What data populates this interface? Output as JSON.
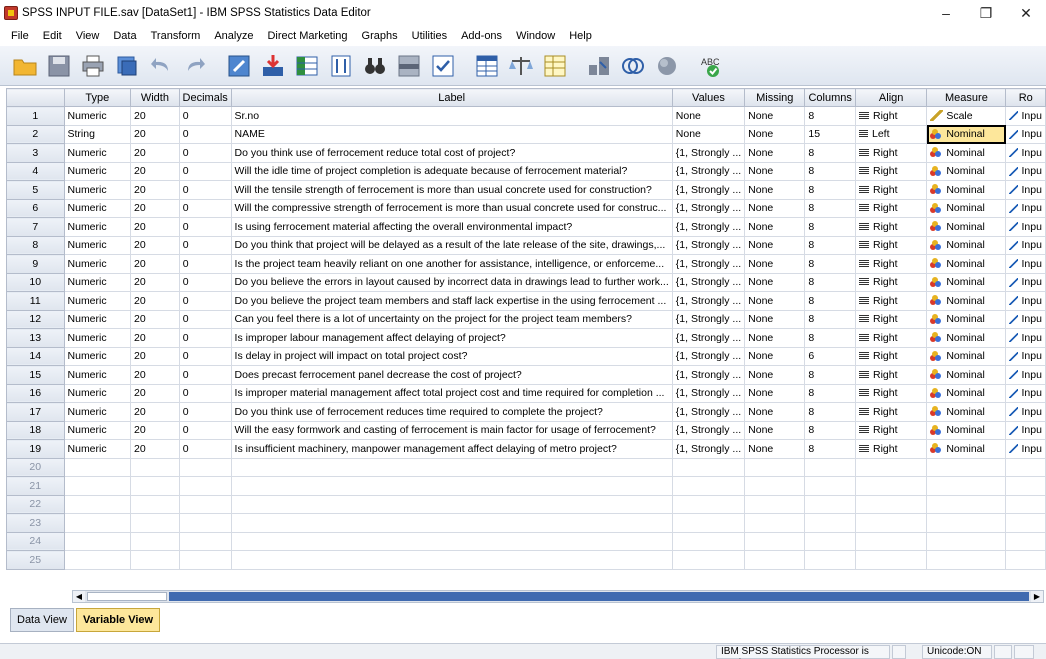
{
  "window": {
    "title": "SPSS INPUT FILE.sav [DataSet1] - IBM SPSS Statistics Data Editor",
    "minimize": "–",
    "maximize": "❐",
    "close": "✕"
  },
  "menubar": [
    {
      "label": "File"
    },
    {
      "label": "Edit"
    },
    {
      "label": "View"
    },
    {
      "label": "Data"
    },
    {
      "label": "Transform"
    },
    {
      "label": "Analyze"
    },
    {
      "label": "Direct Marketing"
    },
    {
      "label": "Graphs"
    },
    {
      "label": "Utilities"
    },
    {
      "label": "Add-ons"
    },
    {
      "label": "Window"
    },
    {
      "label": "Help"
    }
  ],
  "toolbar": {
    "spell_label": "ABC"
  },
  "grid": {
    "columns": [
      "",
      "Type",
      "Width",
      "Decimals",
      "Label",
      "Values",
      "Missing",
      "Columns",
      "Align",
      "Measure",
      "Ro"
    ],
    "rows": [
      {
        "n": "1",
        "type": "Numeric",
        "width": "20",
        "decimals": "0",
        "label": "Sr.no",
        "values": "None",
        "missing": "None",
        "columns": "8",
        "align": "Right",
        "measure": "Scale",
        "role": "Inpu"
      },
      {
        "n": "2",
        "type": "String",
        "width": "20",
        "decimals": "0",
        "label": "NAME",
        "values": "None",
        "missing": "None",
        "columns": "15",
        "align": "Left",
        "measure": "Nominal",
        "role": "Inpu"
      },
      {
        "n": "3",
        "type": "Numeric",
        "width": "20",
        "decimals": "0",
        "label": "Do you think use of ferrocement reduce total cost of project?",
        "values": "{1, Strongly ...",
        "missing": "None",
        "columns": "8",
        "align": "Right",
        "measure": "Nominal",
        "role": "Inpu"
      },
      {
        "n": "4",
        "type": "Numeric",
        "width": "20",
        "decimals": "0",
        "label": "Will the idle time of project completion is adequate because of ferrocement material?",
        "values": "{1, Strongly ...",
        "missing": "None",
        "columns": "8",
        "align": "Right",
        "measure": "Nominal",
        "role": "Inpu"
      },
      {
        "n": "5",
        "type": "Numeric",
        "width": "20",
        "decimals": "0",
        "label": "Will the tensile strength of ferrocement is more than usual concrete used for construction?",
        "values": "{1, Strongly ...",
        "missing": "None",
        "columns": "8",
        "align": "Right",
        "measure": "Nominal",
        "role": "Inpu"
      },
      {
        "n": "6",
        "type": "Numeric",
        "width": "20",
        "decimals": "0",
        "label": "Will the compressive strength of ferrocement is more than usual concrete used for construc...",
        "values": "{1, Strongly ...",
        "missing": "None",
        "columns": "8",
        "align": "Right",
        "measure": "Nominal",
        "role": "Inpu"
      },
      {
        "n": "7",
        "type": "Numeric",
        "width": "20",
        "decimals": "0",
        "label": "Is using ferrocement material affecting the overall environmental impact?",
        "values": "{1, Strongly ...",
        "missing": "None",
        "columns": "8",
        "align": "Right",
        "measure": "Nominal",
        "role": "Inpu"
      },
      {
        "n": "8",
        "type": "Numeric",
        "width": "20",
        "decimals": "0",
        "label": "Do you think that project will be delayed as a result of the late release of the site, drawings,...",
        "values": "{1, Strongly ...",
        "missing": "None",
        "columns": "8",
        "align": "Right",
        "measure": "Nominal",
        "role": "Inpu"
      },
      {
        "n": "9",
        "type": "Numeric",
        "width": "20",
        "decimals": "0",
        "label": "Is the project team heavily reliant on one another for assistance, intelligence, or enforceme...",
        "values": "{1, Strongly ...",
        "missing": "None",
        "columns": "8",
        "align": "Right",
        "measure": "Nominal",
        "role": "Inpu"
      },
      {
        "n": "10",
        "type": "Numeric",
        "width": "20",
        "decimals": "0",
        "label": "Do you believe the errors in layout caused by incorrect data in drawings lead to further work...",
        "values": "{1, Strongly ...",
        "missing": "None",
        "columns": "8",
        "align": "Right",
        "measure": "Nominal",
        "role": "Inpu"
      },
      {
        "n": "11",
        "type": "Numeric",
        "width": "20",
        "decimals": "0",
        "label": "Do you believe the project team members and staff lack expertise in the using ferrocement ...",
        "values": "{1, Strongly ...",
        "missing": "None",
        "columns": "8",
        "align": "Right",
        "measure": "Nominal",
        "role": "Inpu"
      },
      {
        "n": "12",
        "type": "Numeric",
        "width": "20",
        "decimals": "0",
        "label": "Can you feel there is a lot of uncertainty on the project for the project team members?",
        "values": "{1, Strongly ...",
        "missing": "None",
        "columns": "8",
        "align": "Right",
        "measure": "Nominal",
        "role": "Inpu"
      },
      {
        "n": "13",
        "type": "Numeric",
        "width": "20",
        "decimals": "0",
        "label": "Is improper labour management affect delaying of project?",
        "values": "{1, Strongly ...",
        "missing": "None",
        "columns": "8",
        "align": "Right",
        "measure": "Nominal",
        "role": "Inpu"
      },
      {
        "n": "14",
        "type": "Numeric",
        "width": "20",
        "decimals": "0",
        "label": "Is delay in project will impact on total project cost?",
        "values": "{1, Strongly ...",
        "missing": "None",
        "columns": "6",
        "align": "Right",
        "measure": "Nominal",
        "role": "Inpu"
      },
      {
        "n": "15",
        "type": "Numeric",
        "width": "20",
        "decimals": "0",
        "label": "Does precast ferrocement panel decrease the cost of project?",
        "values": "{1, Strongly ...",
        "missing": "None",
        "columns": "8",
        "align": "Right",
        "measure": "Nominal",
        "role": "Inpu"
      },
      {
        "n": "16",
        "type": "Numeric",
        "width": "20",
        "decimals": "0",
        "label": "Is improper material management affect total project cost and time required for completion ...",
        "values": "{1, Strongly ...",
        "missing": "None",
        "columns": "8",
        "align": "Right",
        "measure": "Nominal",
        "role": "Inpu"
      },
      {
        "n": "17",
        "type": "Numeric",
        "width": "20",
        "decimals": "0",
        "label": "Do you think use of ferrocement reduces time required to complete the project?",
        "values": "{1, Strongly ...",
        "missing": "None",
        "columns": "8",
        "align": "Right",
        "measure": "Nominal",
        "role": "Inpu"
      },
      {
        "n": "18",
        "type": "Numeric",
        "width": "20",
        "decimals": "0",
        "label": "Will the easy formwork and casting of ferrocement is main factor for usage of ferrocement?",
        "values": "{1, Strongly ...",
        "missing": "None",
        "columns": "8",
        "align": "Right",
        "measure": "Nominal",
        "role": "Inpu"
      },
      {
        "n": "19",
        "type": "Numeric",
        "width": "20",
        "decimals": "0",
        "label": "Is insufficient machinery, manpower management affect delaying of metro project?",
        "values": "{1, Strongly ...",
        "missing": "None",
        "columns": "8",
        "align": "Right",
        "measure": "Nominal",
        "role": "Inpu"
      }
    ],
    "empty_rows": [
      "20",
      "21",
      "22",
      "23",
      "24",
      "25"
    ]
  },
  "tabs": [
    {
      "label": "Data View",
      "active": false
    },
    {
      "label": "Variable View",
      "active": true
    }
  ],
  "status": {
    "processor": "IBM SPSS Statistics Processor is ready",
    "unicode": "Unicode:ON"
  }
}
